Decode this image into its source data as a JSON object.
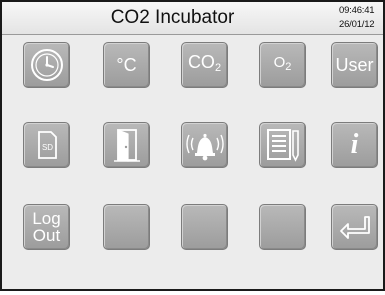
{
  "header": {
    "title": "CO2 Incubator",
    "time": "09:46:41",
    "date": "26/01/12"
  },
  "buttons": {
    "clock": {
      "icon": "clock-icon"
    },
    "celsius": {
      "label": "°C"
    },
    "co2": {
      "label": "CO",
      "sub": "2"
    },
    "o2": {
      "label": "O",
      "sub": "2"
    },
    "user": {
      "label": "User"
    },
    "sd": {
      "icon": "sd-card-icon",
      "label": "SD"
    },
    "door": {
      "icon": "door-icon"
    },
    "alarm": {
      "icon": "alarm-bell-icon"
    },
    "log": {
      "icon": "document-log-icon"
    },
    "info": {
      "icon": "info-icon",
      "label": "i"
    },
    "logout": {
      "line1": "Log",
      "line2": "Out"
    },
    "enter": {
      "icon": "enter-return-icon"
    }
  },
  "colors": {
    "button_fill": "#a9a9a9",
    "header_bg": "#eeeeee",
    "screen_bg": "#ececec",
    "border": "#1a1a1a"
  }
}
